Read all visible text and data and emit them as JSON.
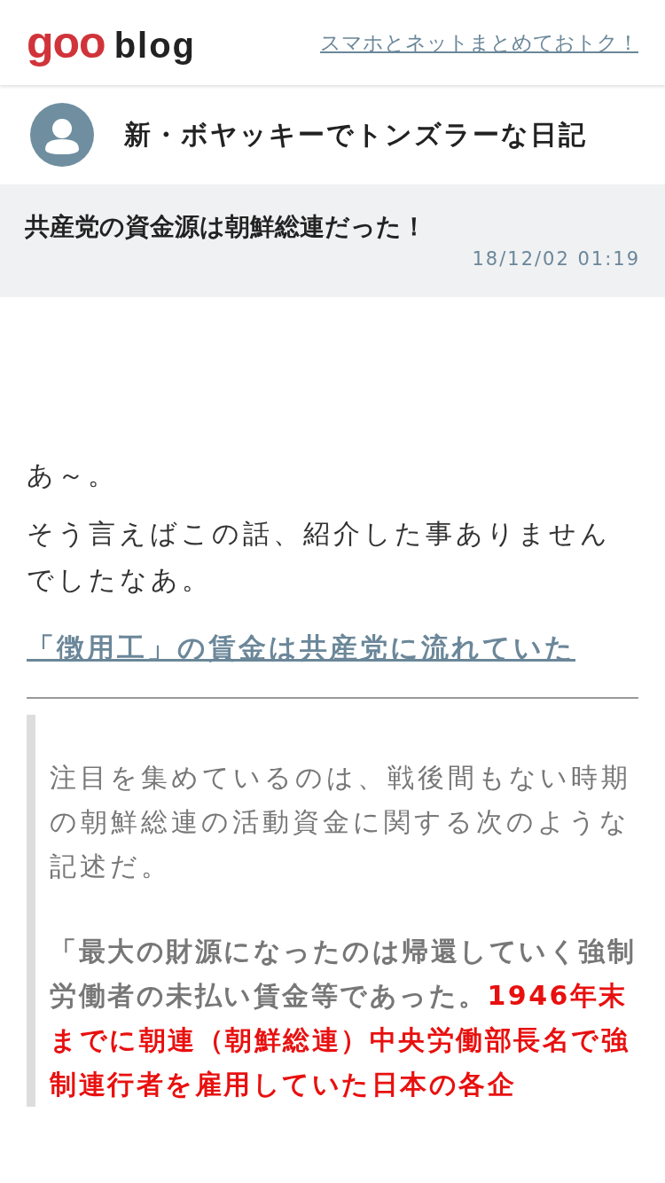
{
  "header": {
    "logo": "goo",
    "logo_suffix": "blog",
    "promo_link": "スマホとネットまとめておトク！"
  },
  "blog": {
    "name": "新・ボヤッキーでトンズラーな日記"
  },
  "entry": {
    "title": "共産党の資金源は朝鮮総連だった！",
    "date": "18/12/02 01:19"
  },
  "body": [
    {
      "kind": "text",
      "text": "あ～。"
    },
    {
      "kind": "text",
      "text": "そう言えばこの話、紹介した事ありませんでしたなあ。"
    },
    {
      "kind": "link",
      "text": "「徴用工」の賃金は共産党に流れていた"
    }
  ],
  "quote": [
    {
      "kind": "plain",
      "segments": [
        {
          "kind": "normal",
          "text": "注目を集めているのは、戦後間もない時期の朝鮮総連の活動資金に関する次のような記述だ。"
        }
      ]
    },
    {
      "kind": "strong",
      "segments": [
        {
          "kind": "normal",
          "text": "「最大の財源になったのは帰還していく強制労働者の未払い賃金等であった。"
        },
        {
          "kind": "red",
          "text": "1946年末までに朝連（朝鮮総連）中央労働部長名で強制連行者を雇用していた日本の各企"
        }
      ]
    }
  ]
}
